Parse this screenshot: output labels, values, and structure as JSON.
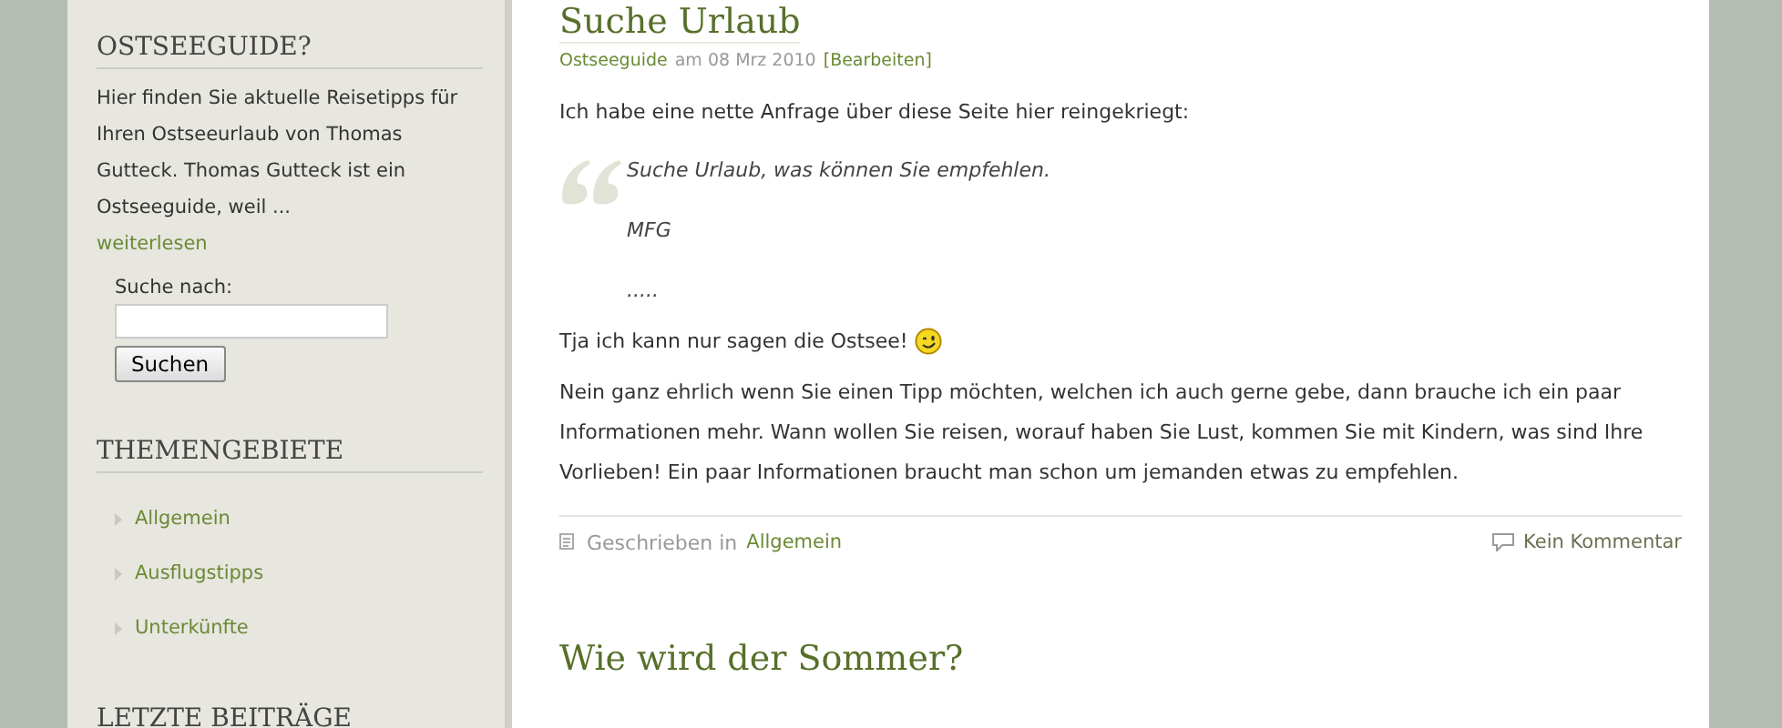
{
  "sidebar": {
    "about": {
      "heading": "OSTSEEGUIDE?",
      "text": "Hier finden Sie aktuelle Reisetipps für Ihren Ostseeurlaub von Thomas Gutteck. Thomas Gutteck ist ein Ostseeguide, weil ...",
      "link": "weiterlesen"
    },
    "search": {
      "label": "Suche nach:",
      "button": "Suchen"
    },
    "categories": {
      "heading": "THEMENGEBIETE",
      "items": [
        "Allgemein",
        "Ausflugstipps",
        "Unterkünfte"
      ]
    },
    "recent": {
      "heading": "LETZTE BEITRÄGE"
    }
  },
  "posts": [
    {
      "title": "Suche Urlaub",
      "author": "Ostseeguide",
      "date": "am 08 Mrz 2010",
      "edit": "[Bearbeiten]",
      "intro": "Ich habe eine nette Anfrage über diese Seite hier reingekriegt:",
      "quote": [
        "Suche Urlaub, was können Sie empfehlen.",
        "MFG",
        "....."
      ],
      "smiley_line": "Tja ich kann nur sagen die Ostsee!",
      "body": "Nein ganz ehrlich wenn Sie einen Tipp möchten, welchen ich auch gerne gebe, dann brauche ich ein paar Informationen mehr. Wann wollen Sie reisen, worauf haben Sie Lust, kommen Sie mit Kindern, was sind Ihre Vorlieben! Ein paar Informationen braucht man schon um jemanden etwas zu empfehlen.",
      "written_in": "Geschrieben in",
      "category": "Allgemein",
      "comments": "Kein Kommentar"
    },
    {
      "title": "Wie wird der Sommer?"
    }
  ]
}
